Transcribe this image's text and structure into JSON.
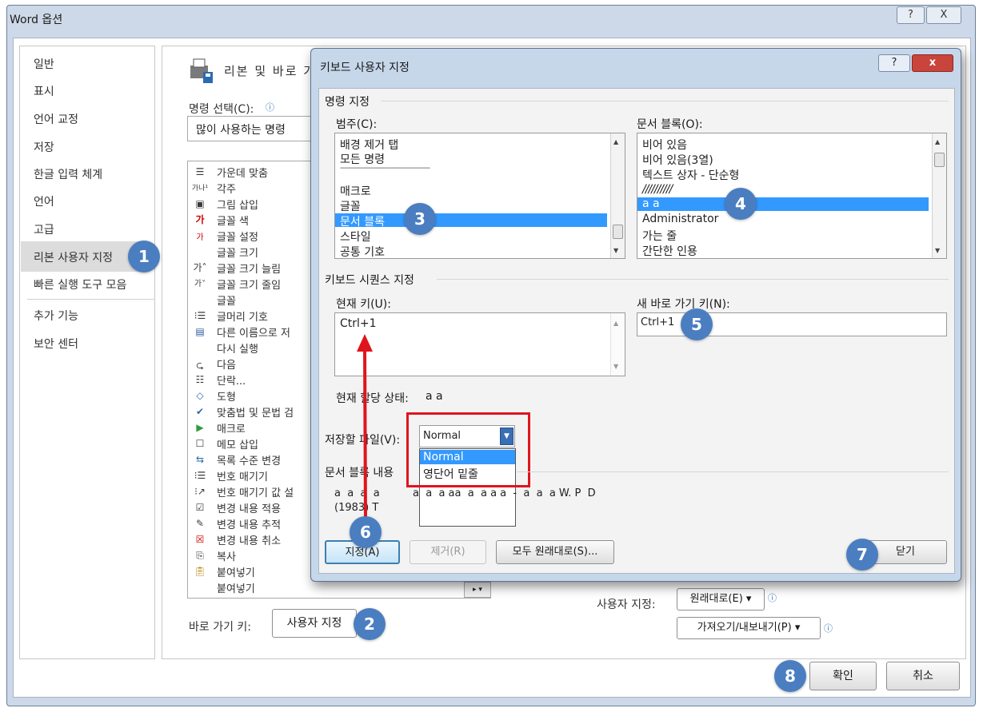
{
  "window": {
    "title": "Word 옵션",
    "help_glyph": "?",
    "close_glyph": "X"
  },
  "nav": {
    "items": [
      "일반",
      "표시",
      "언어 교정",
      "저장",
      "한글 입력 체계",
      "언어",
      "고급",
      "리본 사용자 지정",
      "빠른 실행 도구 모음",
      "추가 기능",
      "보안 센터"
    ],
    "selected": "리본 사용자 지정"
  },
  "main": {
    "header": "리본 및 바로 가",
    "choose_label": "명령 선택(C):",
    "choose_value": "많이 사용하는 명령",
    "commands": [
      "가운데 맞춤",
      "각주",
      "그림 삽입",
      "글꼴 색",
      "글꼴 설정",
      "글꼴 크기",
      "글꼴 크기 늘림",
      "글꼴 크기 줄임",
      "글꼴",
      "글머리 기호",
      "다른 이름으로 저",
      "다시 실행",
      "다음",
      "단락...",
      "도형",
      "맞춤법 및 문법 검",
      "매크로",
      "메모 삽입",
      "목록 수준 변경",
      "번호 매기기",
      "번호 매기기 값 설",
      "변경 내용 적용",
      "변경 내용 추적",
      "변경 내용 취소",
      "복사",
      "붙여넣기",
      "붙여넣기"
    ],
    "shortcut_label": "바로 가기 키:",
    "shortcut_button": "사용자 지정",
    "custom_label": "사용자 지정:",
    "reset_button": "원래대로(E) ▾",
    "import_export_button": "가져오기/내보내기(P) ▾",
    "ok_button": "확인",
    "cancel_button": "취소"
  },
  "dialog": {
    "title": "키보드 사용자 지정",
    "help_glyph": "?",
    "close_glyph": "x",
    "specify_section": "명령 지정",
    "categories_label": "범주(C):",
    "categories": [
      "배경 제거 탭",
      "모든 명령",
      "-------------------------------------------",
      "매크로",
      "글꼴",
      "문서 블록",
      "스타일",
      "공통 기호"
    ],
    "categories_selected": "문서 블록",
    "blocks_label": "문서 블록(O):",
    "blocks": [
      "비어 있음",
      "비어 있음(3열)",
      "텍스트 상자 - 단순형",
      "//////////",
      "a  a",
      "Administrator",
      "가는 줄",
      "간단한 인용"
    ],
    "blocks_selected": "a  a",
    "sequence_section": "키보드 시퀀스 지정",
    "current_keys_label": "현재 키(U):",
    "current_keys_value": "Ctrl+1",
    "new_key_label": "새 바로 가기 키(N):",
    "new_key_value": "Ctrl+1",
    "assigned_label": "현재 할당 상태:",
    "assigned_value": "a  a",
    "save_in_label": "저장할 파일(V):",
    "save_in_value": "Normal",
    "save_in_options": [
      "Normal",
      "영단어 밑줄"
    ],
    "description_label": "문서 블록 내용",
    "description_text": "a  a  a  a          a  a  a aa  a  a a a  -  a  a  a W. P  D",
    "description_text2": "(1983) T",
    "assign_button": "지정(A)",
    "remove_button": "제거(R)",
    "reset_all_button": "모두 원래대로(S)...",
    "close_button": "닫기"
  },
  "badges": [
    "1",
    "2",
    "3",
    "4",
    "5",
    "6",
    "7",
    "8"
  ],
  "colors": {
    "badge": "#4a7ec0",
    "selection": "#3399ff",
    "highlight_box": "#e0141e",
    "arrow": "#e0141e"
  }
}
